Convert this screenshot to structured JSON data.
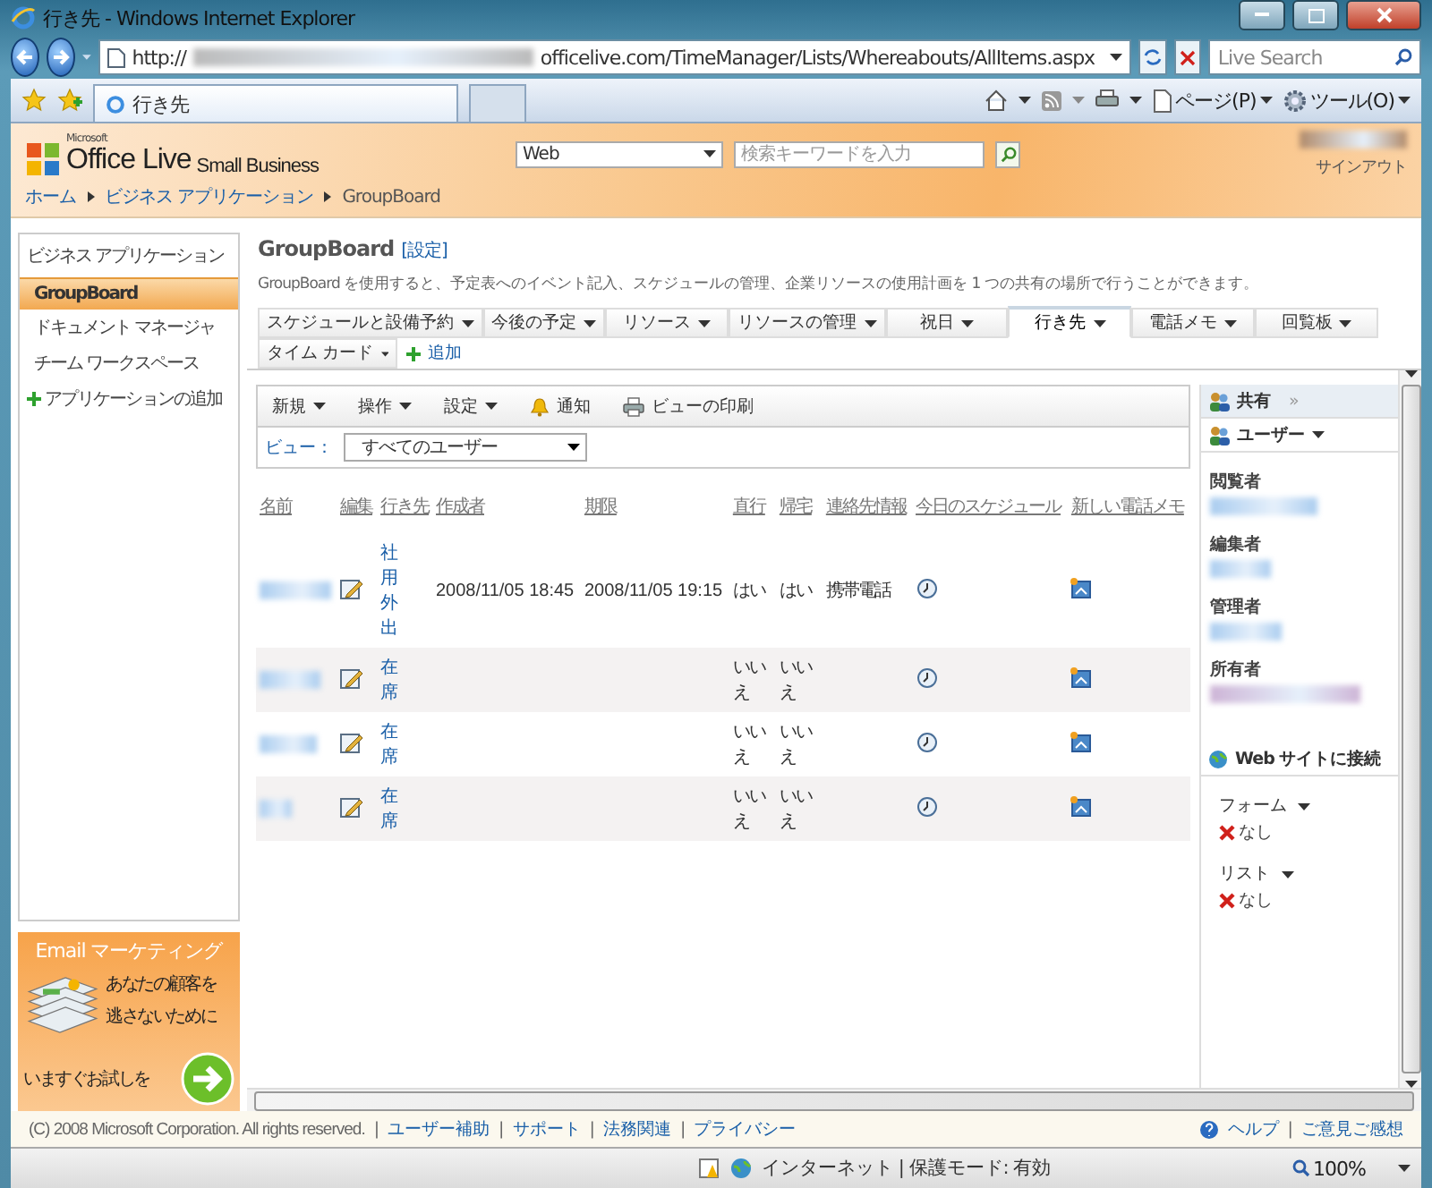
{
  "window": {
    "title": "行き先 - Windows Internet Explorer"
  },
  "address_bar": {
    "url_start": "http://",
    "url_end": "officelive.com/TimeManager/Lists/Whereabouts/AllItems.aspx"
  },
  "search_box": {
    "placeholder": "Live Search"
  },
  "browser_tabs": [
    {
      "label": "行き先",
      "selected": true
    }
  ],
  "command_bar": [
    {
      "label": "ページ(P)",
      "kind": "page"
    },
    {
      "label": "ツール(O)",
      "kind": "tools"
    }
  ],
  "site_header": {
    "logo_small": "Microsoft",
    "logo": "Office Live",
    "logo_suffix": "Small Business",
    "search_scope": "Web",
    "search_placeholder": "検索キーワードを入力",
    "sign_out": "サインアウト"
  },
  "breadcrumb": [
    "ホーム",
    "ビジネス アプリケーション",
    "GroupBoard"
  ],
  "sidebar": {
    "heading": "ビジネス アプリケーション",
    "items": [
      {
        "label": "GroupBoard",
        "selected": true
      },
      {
        "label": "ドキュメント マネージャ",
        "selected": false
      },
      {
        "label": "チーム ワークスペース",
        "selected": false
      }
    ],
    "add_link": "アプリケーションの追加"
  },
  "ad": {
    "title": "Email マーケティング",
    "lines": [
      "あなたの顧客を",
      "逃さないために"
    ],
    "cta": "いますぐお試しを"
  },
  "page": {
    "title": "GroupBoard",
    "settings_link": "[設定]",
    "description": "GroupBoard を使用すると、予定表へのイベント記入、スケジュールの管理、企業リソースの使用計画を 1 つの共有の場所で行うことができます。"
  },
  "app_tabs": [
    {
      "label": "スケジュールと設備予約",
      "selected": false
    },
    {
      "label": "今後の予定",
      "selected": false
    },
    {
      "label": "リソース",
      "selected": false
    },
    {
      "label": "リソースの管理",
      "selected": false
    },
    {
      "label": "祝日",
      "selected": false
    },
    {
      "label": "行き先",
      "selected": true
    },
    {
      "label": "電話メモ",
      "selected": false
    },
    {
      "label": "回覧板",
      "selected": false
    }
  ],
  "app_tabs_row2": [
    {
      "label": "タイム カード",
      "selected": false
    }
  ],
  "add_tab": "追加",
  "toolbar": [
    {
      "label": "新規",
      "kind": "menu"
    },
    {
      "label": "操作",
      "kind": "menu"
    },
    {
      "label": "設定",
      "kind": "menu"
    },
    {
      "label": "通知",
      "kind": "alert"
    },
    {
      "label": "ビューの印刷",
      "kind": "print"
    }
  ],
  "view": {
    "label": "ビュー：",
    "value": "すべてのユーザー"
  },
  "table": {
    "columns": [
      "名前",
      "編集",
      "行き先",
      "作成者",
      "期限",
      "直行",
      "帰宅",
      "連絡先情報",
      "今日のスケジュール",
      "新しい電話メモ"
    ],
    "rows": [
      {
        "location": "社用外出",
        "created_by": "2008/11/05 18:45",
        "due": "2008/11/05 19:15",
        "direct": "はい",
        "go_home": "はい",
        "contact": "携帯電話"
      },
      {
        "location": "在席",
        "direct": "いいえ",
        "go_home": "いいえ"
      },
      {
        "location": "在席",
        "direct": "いいえ",
        "go_home": "いいえ"
      },
      {
        "location": "在席",
        "direct": "いいえ",
        "go_home": "いいえ"
      }
    ]
  },
  "right_panel": {
    "title": "共有",
    "expand_glyph": "»",
    "users_menu": "ユーザー",
    "roles": [
      "閲覧者",
      "編集者",
      "管理者",
      "所有者"
    ],
    "web_connect": "Web サイトに接続",
    "sections": [
      {
        "title": "フォーム",
        "empty": "なし"
      },
      {
        "title": "リスト",
        "empty": "なし"
      }
    ]
  },
  "footer": {
    "copyright": "(C) 2008 Microsoft Corporation. All rights reserved.",
    "separator": "|",
    "links": [
      "ユーザー補助",
      "サポート",
      "法務関連",
      "プライバシー"
    ],
    "right_links": [
      "ヘルプ",
      "ご意見ご感想"
    ]
  },
  "status_bar": {
    "zone": "インターネット | 保護モード: 有効",
    "zoom": "100%"
  }
}
